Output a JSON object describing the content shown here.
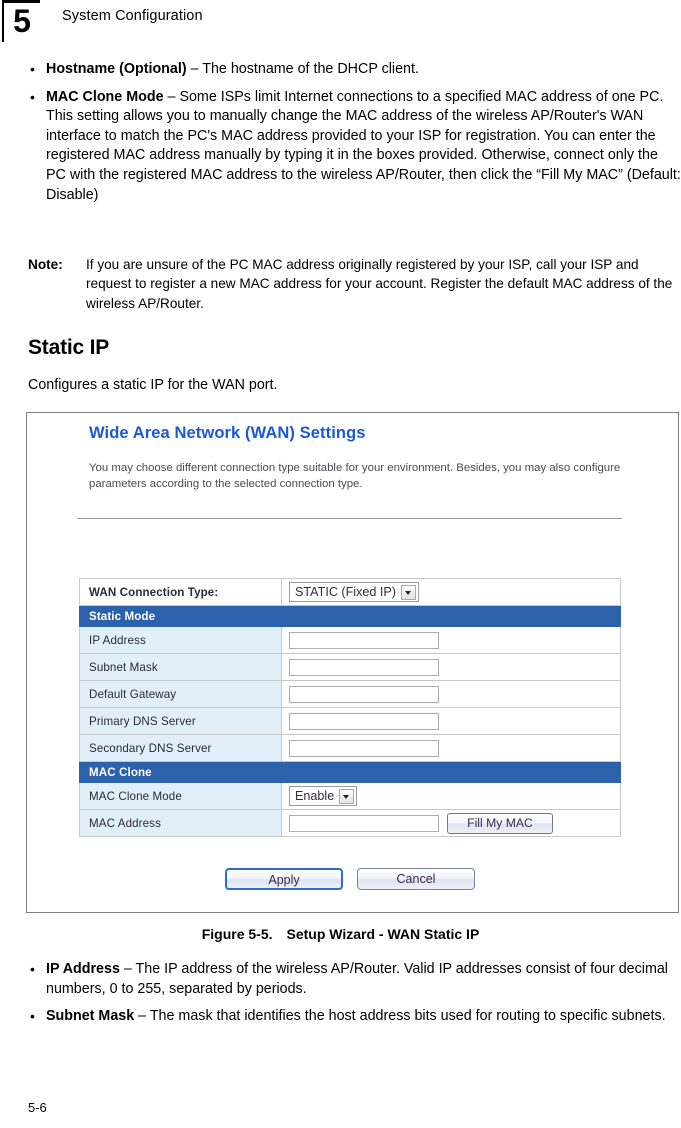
{
  "header": {
    "chapter_number": "5",
    "title": "System Configuration"
  },
  "intro_bullets": [
    {
      "term": "Hostname (Optional)",
      "text": " – The hostname of the DHCP client."
    },
    {
      "term": "MAC Clone Mode",
      "text": " – Some ISPs limit Internet connections to a specified MAC address of one PC. This setting allows you to manually change the MAC address of the wireless AP/Router's WAN interface to match the PC's MAC address provided to your ISP for registration. You can enter the registered MAC address manually by typing it in the boxes provided. Otherwise, connect only the PC with the registered MAC address to the wireless AP/Router, then click the “Fill My MAC” (Default: Disable)"
    }
  ],
  "note": {
    "label": "Note:",
    "text": "If you are unsure of the PC MAC address originally registered by your ISP, call your ISP and request to register a new MAC address for your account. Register the default MAC address of the wireless AP/Router."
  },
  "section": {
    "heading": "Static IP",
    "intro": "Configures a static IP for the WAN port."
  },
  "figure": {
    "panel_title": "Wide Area Network (WAN) Settings",
    "panel_description": "You may choose different connection type suitable for your environment. Besides, you may also configure parameters according to the selected connection type.",
    "connection_type": {
      "label": "WAN Connection Type:",
      "selected": "STATIC (Fixed IP)"
    },
    "sections": [
      {
        "title": "Static Mode",
        "rows": [
          {
            "label": "IP Address",
            "value": "",
            "control": "text"
          },
          {
            "label": "Subnet Mask",
            "value": "",
            "control": "text"
          },
          {
            "label": "Default Gateway",
            "value": "",
            "control": "text"
          },
          {
            "label": "Primary DNS Server",
            "value": "",
            "control": "text"
          },
          {
            "label": "Secondary DNS Server",
            "value": "",
            "control": "text"
          }
        ]
      },
      {
        "title": "MAC Clone",
        "rows": [
          {
            "label": "MAC Clone Mode",
            "value": "Enable",
            "control": "select"
          },
          {
            "label": "MAC Address",
            "value": "",
            "control": "text-with-button",
            "button": "Fill My MAC"
          }
        ]
      }
    ],
    "buttons": {
      "apply": "Apply",
      "cancel": "Cancel"
    },
    "colors": {
      "panel_title": "#1a59d8",
      "section_header_bg": "#2b62ab",
      "label_cell_bg": "#e1f0f8",
      "frame_border": "#808080"
    }
  },
  "caption": {
    "number": "Figure 5-5.",
    "text": "Setup Wizard - WAN Static IP"
  },
  "trailing_bullets": [
    {
      "term": "IP Address",
      "text": " – The IP address of the wireless AP/Router. Valid IP addresses consist of four decimal numbers, 0 to 255, separated by periods."
    },
    {
      "term": "Subnet Mask",
      "text": " – The mask that identifies the host address bits used for routing to specific subnets."
    }
  ],
  "footer": {
    "page_number": "5-6"
  }
}
